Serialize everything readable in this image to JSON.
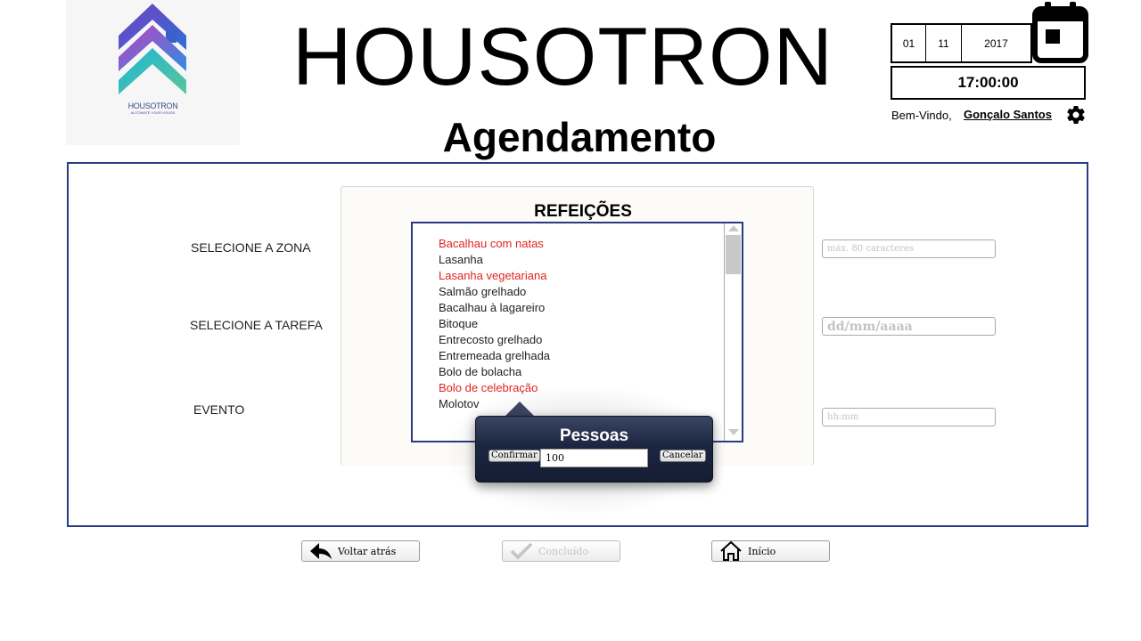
{
  "header": {
    "logo_text": "HOUSOTRON",
    "logo_tagline": "AUTOMATE YOUR HOUSE",
    "app_title": "HOUSOTRON",
    "page_title": "Agendamento"
  },
  "datetime": {
    "day": "01",
    "month": "11",
    "year": "2017",
    "time": "17:00:00"
  },
  "user": {
    "welcome": "Bem-Vindo,",
    "name": "Gonçalo Santos"
  },
  "form": {
    "zone_label": "SELECIONE A ZONA",
    "task_label": "SELECIONE A TAREFA",
    "event_label": "EVENTO",
    "text_placeholder": "máx. 80 caracteres",
    "date_placeholder": "dd/mm/aaaa",
    "time_placeholder": "hh:mm"
  },
  "meals": {
    "title": "REFEIÇÕES",
    "items": [
      {
        "label": "Bacalhau com natas",
        "highlight": true
      },
      {
        "label": "Lasanha",
        "highlight": false
      },
      {
        "label": "Lasanha vegetariana",
        "highlight": true
      },
      {
        "label": "Salmão grelhado",
        "highlight": false
      },
      {
        "label": "Bacalhau à lagareiro",
        "highlight": false
      },
      {
        "label": "Bitoque",
        "highlight": false
      },
      {
        "label": "Entrecosto grelhado",
        "highlight": false
      },
      {
        "label": "Entremeada grelhada",
        "highlight": false
      },
      {
        "label": "Bolo de bolacha",
        "highlight": false
      },
      {
        "label": "Bolo de celebração",
        "highlight": true
      },
      {
        "label": "Molotov",
        "highlight": false
      }
    ]
  },
  "popover": {
    "title": "Pessoas",
    "confirm_label": "Confirmar",
    "cancel_label": "Cancelar",
    "people_value": "100"
  },
  "nav": {
    "back_label": "Voltar atrás",
    "done_label": "Concluído",
    "home_label": "Início"
  },
  "colors": {
    "accent_border": "#2b3a85",
    "highlight_text": "#e3231f",
    "popover_bg": "#1c2640"
  }
}
